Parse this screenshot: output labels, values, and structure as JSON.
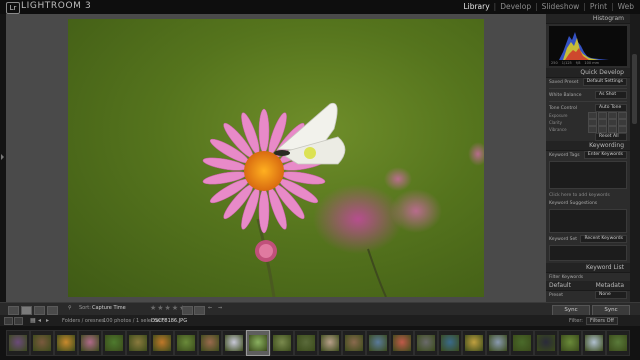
{
  "app": {
    "logo": "Lr",
    "title": "LIGHTROOM 3",
    "modules": [
      {
        "label": "Library",
        "active": true
      },
      {
        "label": "Develop",
        "active": false
      },
      {
        "label": "Slideshow",
        "active": false
      },
      {
        "label": "Print",
        "active": false
      },
      {
        "label": "Web",
        "active": false
      }
    ],
    "module_separator": "|"
  },
  "right_panel": {
    "histogram_title": "Histogram",
    "histogram_info": [
      "250",
      "1/125",
      "f/8",
      "100 mm"
    ],
    "quick_develop": {
      "title": "Quick Develop",
      "saved_preset_label": "Saved Preset",
      "saved_preset_value": "Default Settings",
      "white_balance_label": "White Balance",
      "white_balance_value": "As Shot",
      "tone_control_label": "Tone Control",
      "tone_control_value": "Auto Tone",
      "controls": [
        "Exposure",
        "Clarity",
        "Vibrance"
      ],
      "reset_label": "Reset All"
    },
    "keywording": {
      "title": "Keywording",
      "keyword_tags_label": "Keyword Tags",
      "keyword_tags_value": "Enter Keywords",
      "hint": "Click here to add keywords",
      "suggestions_label": "Keyword Suggestions",
      "set_label": "Keyword Set",
      "set_value": "Recent Keywords"
    },
    "keyword_list_title": "Keyword List",
    "filter_keywords": "Filter Keywords",
    "metadata": {
      "preset": "Default",
      "title": "Metadata",
      "preset_label": "Preset",
      "preset_value": "None"
    },
    "sync_label": "Sync",
    "sync_settings_label": "Sync Settings"
  },
  "toolbar": {
    "sort_label": "Sort:",
    "sort_value": "Capture Time",
    "stars": "★★★★★"
  },
  "filmstrip_header": {
    "folder": "Folders / oresnes",
    "count": "100 photos / 1 selected /",
    "filename": "DSCF8186.JPG",
    "filter_label": "Filter:",
    "filter_value": "Filters Off"
  },
  "filmstrip": {
    "selected_index": 10,
    "thumb_colors": [
      "#6b4a7a",
      "#7a5a3e",
      "#c98a2e",
      "#b06a8a",
      "#4e7a2e",
      "#8a7a3e",
      "#c0782a",
      "#6a8a3a",
      "#9a6a4e",
      "#c8c8d8",
      "#8ab060",
      "#7a8a4e",
      "#5a6a3a",
      "#b8a08a",
      "#8a6a4e",
      "#5a7a9a",
      "#c05a4a",
      "#6a6a6a",
      "#3a6a8a",
      "#c0a040",
      "#8a9ab0",
      "#4a6a2a",
      "#2a2a3a",
      "#6a8a3a",
      "#b0c0d0",
      "#5a7a3a"
    ]
  }
}
